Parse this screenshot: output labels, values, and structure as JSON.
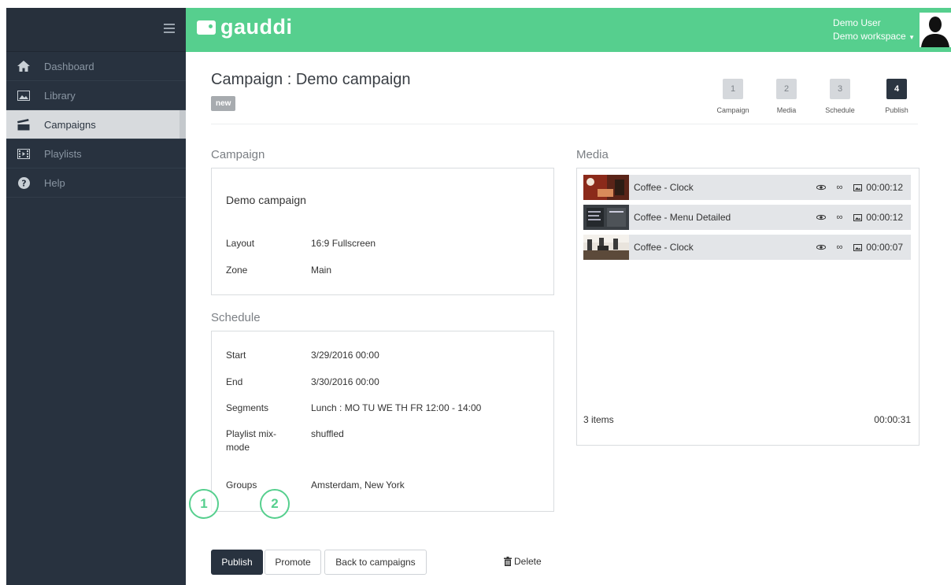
{
  "sidebar": {
    "items": [
      {
        "label": "Dashboard",
        "icon": "home-icon"
      },
      {
        "label": "Library",
        "icon": "image-icon"
      },
      {
        "label": "Campaigns",
        "icon": "clapperboard-icon",
        "active": true
      },
      {
        "label": "Playlists",
        "icon": "film-strip-icon"
      },
      {
        "label": "Help",
        "icon": "help-icon"
      }
    ]
  },
  "topbar": {
    "brand": "gauddi",
    "user_name": "Demo User",
    "workspace": "Demo workspace"
  },
  "page": {
    "title": "Campaign : Demo campaign",
    "status_badge": "new"
  },
  "steps": [
    {
      "num": "1",
      "label": "Campaign"
    },
    {
      "num": "2",
      "label": "Media"
    },
    {
      "num": "3",
      "label": "Schedule"
    },
    {
      "num": "4",
      "label": "Publish",
      "current": true
    }
  ],
  "campaign": {
    "heading": "Campaign",
    "name": "Demo campaign",
    "layout_label": "Layout",
    "layout_value": "16:9 Fullscreen",
    "zone_label": "Zone",
    "zone_value": "Main"
  },
  "schedule": {
    "heading": "Schedule",
    "start_label": "Start",
    "start_value": "3/29/2016 00:00",
    "end_label": "End",
    "end_value": "3/30/2016 00:00",
    "segments_label": "Segments",
    "segments_value": "Lunch : MO TU WE TH FR 12:00 - 14:00",
    "mixmode_label": "Playlist mix-mode",
    "mixmode_value": "shuffled",
    "groups_label": "Groups",
    "groups_value": "Amsterdam, New York"
  },
  "media": {
    "heading": "Media",
    "items": [
      {
        "name": "Coffee - Clock",
        "duration": "00:00:12"
      },
      {
        "name": "Coffee - Menu Detailed",
        "duration": "00:00:12"
      },
      {
        "name": "Coffee - Clock",
        "duration": "00:00:07"
      }
    ],
    "count": "3 items",
    "total": "00:00:31"
  },
  "actions": {
    "publish": "Publish",
    "promote": "Promote",
    "back": "Back to campaigns",
    "delete": "Delete"
  },
  "callouts": [
    "1",
    "2"
  ],
  "colors": {
    "accent": "#56cf8e",
    "sidebar": "#28323f",
    "primary_button": "#28323f"
  }
}
